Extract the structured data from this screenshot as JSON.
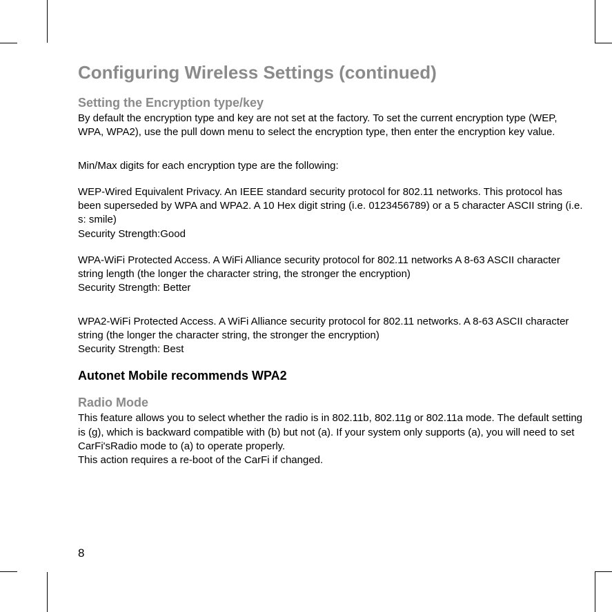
{
  "heading": "Configuring Wireless Settings (continued)",
  "section1": {
    "title": "Setting the Encryption type/key",
    "para1": "By default the encryption type and key are not set at the factory. To set the current encryption type (WEP, WPA, WPA2), use the pull down menu to select the encryption type, then enter the encryption key value.",
    "para2": "Min/Max digits for each encryption type are the following:",
    "wep": "WEP-Wired Equivalent Privacy. An IEEE standard security protocol for 802.11 networks. This protocol has been superseded by WPA and WPA2. A 10 Hex digit string (i.e. 0123456789) or a 5 character ASCII string (i.e. s: smile)",
    "wep_strength": "Security Strength:Good",
    "wpa": "WPA-WiFi Protected Access. A WiFi Alliance security protocol for 802.11 networks A 8-63 ASCII character string length (the longer the character string, the stronger the encryption)",
    "wpa_strength": "Security Strength: Better",
    "wpa2": "WPA2-WiFi Protected Access. A WiFi Alliance security protocol for 802.11 networks. A 8-63 ASCII character string (the longer the character string, the stronger the encryption)",
    "wpa2_strength": "Security Strength: Best"
  },
  "recommend": "Autonet Mobile recommends WPA2",
  "section2": {
    "title": "Radio Mode",
    "para1": "This feature allows you to select whether the radio is in 802.11b, 802.11g or 802.11a mode. The default setting is (g), which is backward compatible with (b) but not (a). If your system only supports (a), you will need to set CarFi'sRadio mode to (a) to operate properly.",
    "para2": "This action requires a re-boot of the CarFi if changed."
  },
  "page_number": "8"
}
